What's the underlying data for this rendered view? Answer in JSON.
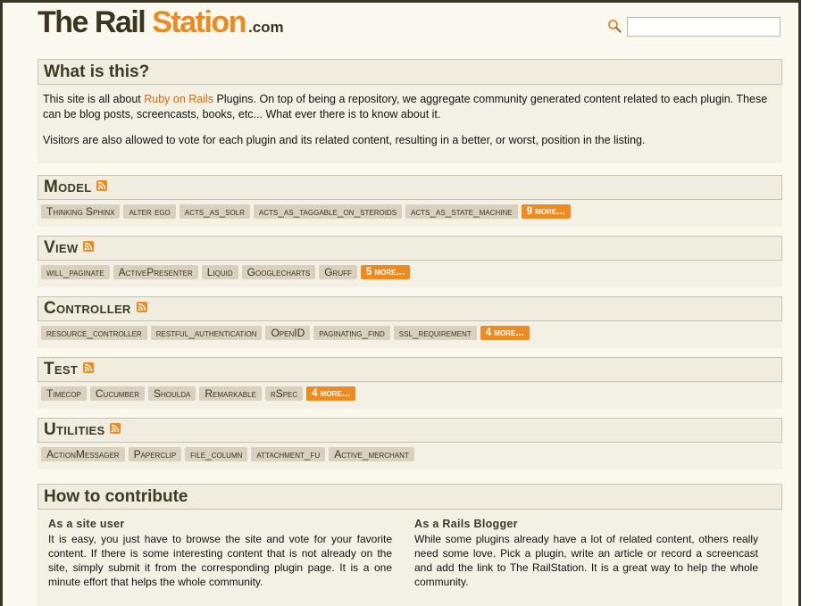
{
  "site": {
    "logo_part1": "The Rail",
    "logo_part2": "Station",
    "logo_part3": ".com",
    "search_value": "",
    "accent_color": "#ec8a1e"
  },
  "what": {
    "title": "What is this?",
    "p1_before": "This site is all about ",
    "p1_link": "Ruby on Rails",
    "p1_after": " Plugins. On top of being a repository, we aggregate community generated content related to each plugin. These can be blog posts, screencasts, books, etc... What ever there is to know about it.",
    "p2": "Visitors are also allowed to vote for each plugin and its related content, resulting in a better, or worst, position in the listing."
  },
  "categories": [
    {
      "name": "Model",
      "tags": [
        "Thinking Sphinx",
        "alter ego",
        "acts_as_solr",
        "acts_as_taggable_on_steroids",
        "acts_as_state_machine"
      ],
      "more": "9 more..."
    },
    {
      "name": "View",
      "tags": [
        "will_paginate",
        "ActivePresenter",
        "Liquid",
        "Googlecharts",
        "Gruff"
      ],
      "more": "5 more..."
    },
    {
      "name": "Controller",
      "tags": [
        "resource_controller",
        "restful_authentication",
        "OpenID",
        "paginating_find",
        "ssl_requirement"
      ],
      "more": "4 more..."
    },
    {
      "name": "Test",
      "tags": [
        "Timecop",
        "Cucumber",
        "Shoulda",
        "Remarkable",
        "rSpec"
      ],
      "more": "4 more..."
    },
    {
      "name": "Utilities",
      "tags": [
        "ActionMessager",
        "Paperclip",
        "file_column",
        "attachment_fu",
        "Active_merchant"
      ],
      "more": ""
    }
  ],
  "how": {
    "title": "How to contribute",
    "user_title": "As a site user",
    "user_text": "It is easy, you just have to browse the site and vote for your favorite content. If there is some interesting content that is not already on the site, simply submit it from the corresponding plugin page. It is a one minute effort that helps the whole community.",
    "blogger_title": "As a Rails Blogger",
    "blogger_text": "While some plugins already have a lot of related content, others really need some love. Pick a plugin, write an article or record a screencast and add the link to The RailStation. It is a great way to help the whole community."
  }
}
